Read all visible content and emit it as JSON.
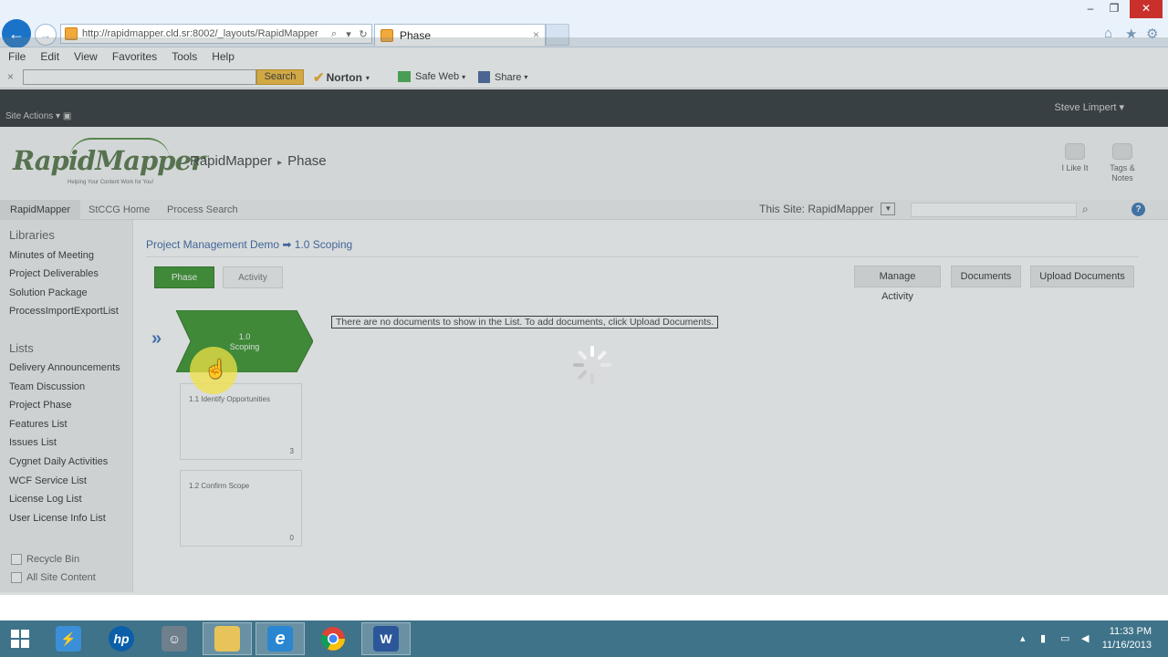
{
  "browser": {
    "url": "http://rapidmapper.cld.sr:8002/_layouts/RapidMapper",
    "tab_title": "Phase",
    "tab_close": "×",
    "menu": [
      "File",
      "Edit",
      "View",
      "Favorites",
      "Tools",
      "Help"
    ],
    "toolbar": {
      "close_glyph": "×",
      "search_label": "Search",
      "norton_label": "Norton",
      "safeweb_label": "Safe Web",
      "share_label": "Share"
    },
    "window_controls": {
      "minimize": "–",
      "restore": "❐",
      "close": "✕"
    }
  },
  "sharepoint": {
    "site_actions": "Site Actions",
    "user": "Steve Limpert",
    "logo_text": "RapidMapper",
    "logo_tm": "™",
    "logo_tagline": "Helping Your Content Work for You!",
    "breadcrumb": {
      "site": "RapidMapper",
      "page": "Phase",
      "sep": "▸"
    },
    "tools": {
      "like": "I Like It",
      "tags": "Tags &",
      "notes": "Notes"
    },
    "topnav": [
      "RapidMapper",
      "StCCG Home",
      "Process Search"
    ],
    "search_scope": "This Site: RapidMapper",
    "leftnav": {
      "libraries_heading": "Libraries",
      "libraries": [
        "Minutes of Meeting",
        "Project Deliverables",
        "Solution Package",
        "ProcessImportExportList"
      ],
      "lists_heading": "Lists",
      "lists": [
        "Delivery Announcements",
        "Team Discussion",
        "Project Phase",
        "Features List",
        "Issues List",
        "Cygnet Daily Activities",
        "WCF Service List",
        "License Log List",
        "User License Info List"
      ],
      "recycle_bin": "Recycle Bin",
      "all_site_content": "All Site Content"
    },
    "main": {
      "page_title": "Project Management Demo ➡ 1.0 Scoping",
      "phase_button": "Phase",
      "activity_button": "Activity",
      "actions": [
        "Manage Activity",
        "Documents",
        "Upload Documents"
      ],
      "phase": {
        "number": "1.0",
        "name": "Scoping"
      },
      "activities": [
        {
          "title": "1.1 Identify Opportunities",
          "count": "3"
        },
        {
          "title": "1.2 Confirm Scope",
          "count": "0"
        }
      ],
      "no_docs_message": "There are no documents to show in the List. To add documents, click Upload Documents."
    }
  },
  "taskbar": {
    "apps": [
      "start",
      "network-tool",
      "hp",
      "lync",
      "file-explorer",
      "internet-explorer",
      "chrome",
      "word"
    ],
    "time": "11:33 PM",
    "date": "11/16/2013"
  },
  "colors": {
    "accent_green": "#2a8c1d",
    "link_blue": "#2c5aa0",
    "ribbon": "#21272d",
    "taskbar": "#3f7389"
  }
}
